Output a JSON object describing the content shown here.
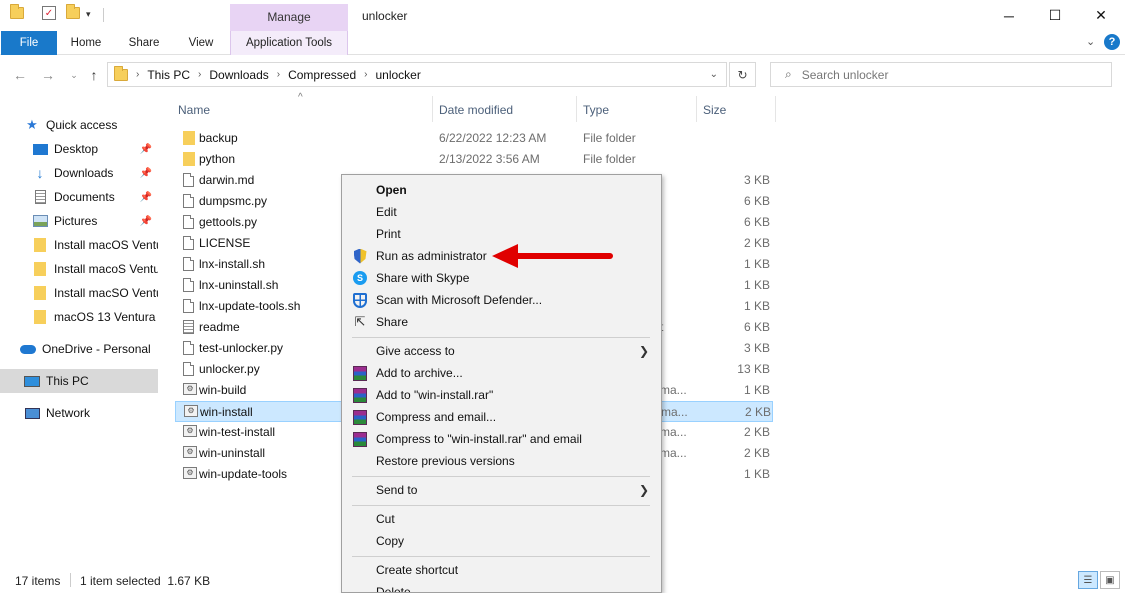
{
  "titlebar": {
    "manage_label": "Manage",
    "window_title": "unlocker",
    "minimize_glyph": "─",
    "maximize_glyph": "☐",
    "close_glyph": "✕"
  },
  "ribbon": {
    "tabs": [
      "File",
      "Home",
      "Share",
      "View",
      "Application Tools"
    ],
    "file_color": "#1979ca",
    "manage_color": "#e8d4f4"
  },
  "address": {
    "crumbs": [
      "This PC",
      "Downloads",
      "Compressed",
      "unlocker"
    ],
    "search_placeholder": "Search unlocker"
  },
  "navpane": {
    "items": [
      {
        "label": "Quick access",
        "icon": "star-icon"
      },
      {
        "label": "Desktop",
        "icon": "desktop-icon",
        "pinned": true
      },
      {
        "label": "Downloads",
        "icon": "download-arrow-icon",
        "pinned": true
      },
      {
        "label": "Documents",
        "icon": "documents-icon",
        "pinned": true
      },
      {
        "label": "Pictures",
        "icon": "pictures-icon",
        "pinned": true
      },
      {
        "label": "Install macOS Ventu",
        "icon": "folder-icon"
      },
      {
        "label": "Install macoS Ventu",
        "icon": "folder-icon"
      },
      {
        "label": "Install macSO Ventu",
        "icon": "folder-icon"
      },
      {
        "label": "macOS 13 Ventura",
        "icon": "folder-icon"
      },
      {
        "label": "OneDrive - Personal",
        "icon": "cloud-icon"
      },
      {
        "label": "This PC",
        "icon": "computer-icon",
        "selected": true
      },
      {
        "label": "Network",
        "icon": "network-icon"
      }
    ]
  },
  "filelist": {
    "columns": [
      "Name",
      "Date modified",
      "Type",
      "Size"
    ],
    "files": [
      {
        "name": "backup",
        "date": "6/22/2022 12:23 AM",
        "type": "File folder",
        "size": "",
        "icon": "folder-icon"
      },
      {
        "name": "python",
        "date": "2/13/2022 3:56 AM",
        "type": "File folder",
        "size": "",
        "icon": "folder-icon"
      },
      {
        "name": "darwin.md",
        "date": "",
        "type": "",
        "size": "3 KB",
        "icon": "document-icon"
      },
      {
        "name": "dumpsmc.py",
        "date": "",
        "type": "",
        "size": "6 KB",
        "icon": "document-icon"
      },
      {
        "name": "gettools.py",
        "date": "",
        "type": "",
        "size": "6 KB",
        "icon": "document-icon"
      },
      {
        "name": "LICENSE",
        "date": "",
        "type": "",
        "size": "2 KB",
        "icon": "document-icon"
      },
      {
        "name": "lnx-install.sh",
        "date": "",
        "type": "",
        "size": "1 KB",
        "icon": "document-icon"
      },
      {
        "name": "lnx-uninstall.sh",
        "date": "",
        "type": "",
        "size": "1 KB",
        "icon": "document-icon"
      },
      {
        "name": "lnx-update-tools.sh",
        "date": "",
        "type": "",
        "size": "1 KB",
        "icon": "document-icon"
      },
      {
        "name": "readme",
        "date": "",
        "type": "t",
        "size": "6 KB",
        "icon": "text-document-icon"
      },
      {
        "name": "test-unlocker.py",
        "date": "",
        "type": "",
        "size": "3 KB",
        "icon": "document-icon"
      },
      {
        "name": "unlocker.py",
        "date": "",
        "type": "",
        "size": "13 KB",
        "icon": "document-icon"
      },
      {
        "name": "win-build",
        "date": "",
        "type": "ma...",
        "size": "1 KB",
        "icon": "batch-file-icon"
      },
      {
        "name": "win-install",
        "date": "",
        "type": "ma...",
        "size": "2 KB",
        "icon": "batch-file-icon",
        "selected": true
      },
      {
        "name": "win-test-install",
        "date": "",
        "type": "ma...",
        "size": "2 KB",
        "icon": "batch-file-icon"
      },
      {
        "name": "win-uninstall",
        "date": "",
        "type": "ma...",
        "size": "2 KB",
        "icon": "batch-file-icon"
      },
      {
        "name": "win-update-tools",
        "date": "",
        "type": "ma...",
        "size": "1 KB",
        "icon": "batch-file-icon"
      }
    ]
  },
  "context_menu": {
    "items": [
      {
        "label": "Open",
        "bold": true,
        "icon": ""
      },
      {
        "label": "Edit",
        "icon": ""
      },
      {
        "label": "Print",
        "icon": ""
      },
      {
        "label": "Run as administrator",
        "icon": "shield-icon"
      },
      {
        "label": "Share with Skype",
        "icon": "skype-icon"
      },
      {
        "label": "Scan with Microsoft Defender...",
        "icon": "defender-icon"
      },
      {
        "label": "Share",
        "icon": "share-icon"
      },
      {
        "separator": true
      },
      {
        "label": "Give access to",
        "icon": "",
        "submenu": true
      },
      {
        "label": "Add to archive...",
        "icon": "winrar-icon"
      },
      {
        "label": "Add to \"win-install.rar\"",
        "icon": "winrar-icon"
      },
      {
        "label": "Compress and email...",
        "icon": "winrar-icon"
      },
      {
        "label": "Compress to \"win-install.rar\" and email",
        "icon": "winrar-icon"
      },
      {
        "label": "Restore previous versions",
        "icon": ""
      },
      {
        "separator": true
      },
      {
        "label": "Send to",
        "icon": "",
        "submenu": true
      },
      {
        "separator": true
      },
      {
        "label": "Cut",
        "icon": ""
      },
      {
        "label": "Copy",
        "icon": ""
      },
      {
        "separator": true
      },
      {
        "label": "Create shortcut",
        "icon": ""
      },
      {
        "label": "Delete",
        "icon": ""
      }
    ],
    "arrow_color": "#e00000"
  },
  "statusbar": {
    "item_count": "17 items",
    "selection": "1 item selected  1.67 KB"
  }
}
